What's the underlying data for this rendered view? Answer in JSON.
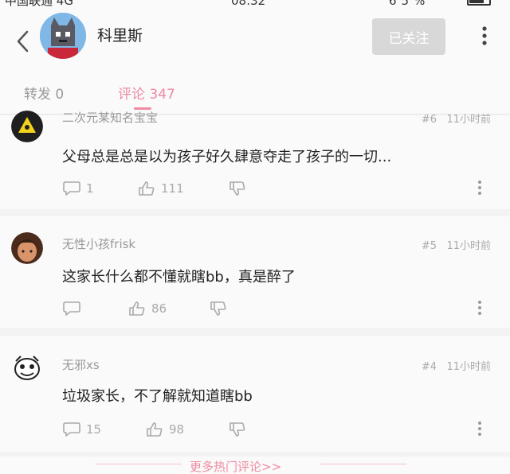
{
  "status_bar": {
    "carrier": "中国联通",
    "network": "4G",
    "time": "08:32",
    "battery": "65%"
  },
  "header": {
    "back_icon": "chevron-left-icon",
    "profile_name": "科里斯",
    "follow_label": "已关注",
    "more_icon": "vertical-dots-icon"
  },
  "tabs": {
    "repost_label": "转发 0",
    "comments_label": "评论 347"
  },
  "comments": [
    {
      "username": "二次元某知名宝宝",
      "floor": "#6",
      "time": "11小时前",
      "text": "父母总是总是以为孩子好久肆意夺走了孩子的一切...",
      "reply_count": "1",
      "like_count": "111"
    },
    {
      "username": "无性小孩frisk",
      "floor": "#5",
      "time": "11小时前",
      "text": "这家长什么都不懂就瞎bb，真是醉了",
      "reply_count": "",
      "like_count": "86"
    },
    {
      "username": "无邪xs",
      "floor": "#4",
      "time": "11小时前",
      "text": "垃圾家长，不了解就知道瞎bb",
      "reply_count": "15",
      "like_count": "98"
    }
  ],
  "more_comments_label": "更多热门评论>>",
  "colors": {
    "accent_pink": "#ef8aa2",
    "muted_gray": "#aaaaaa",
    "follow_button_bg": "#d8d8d8"
  }
}
